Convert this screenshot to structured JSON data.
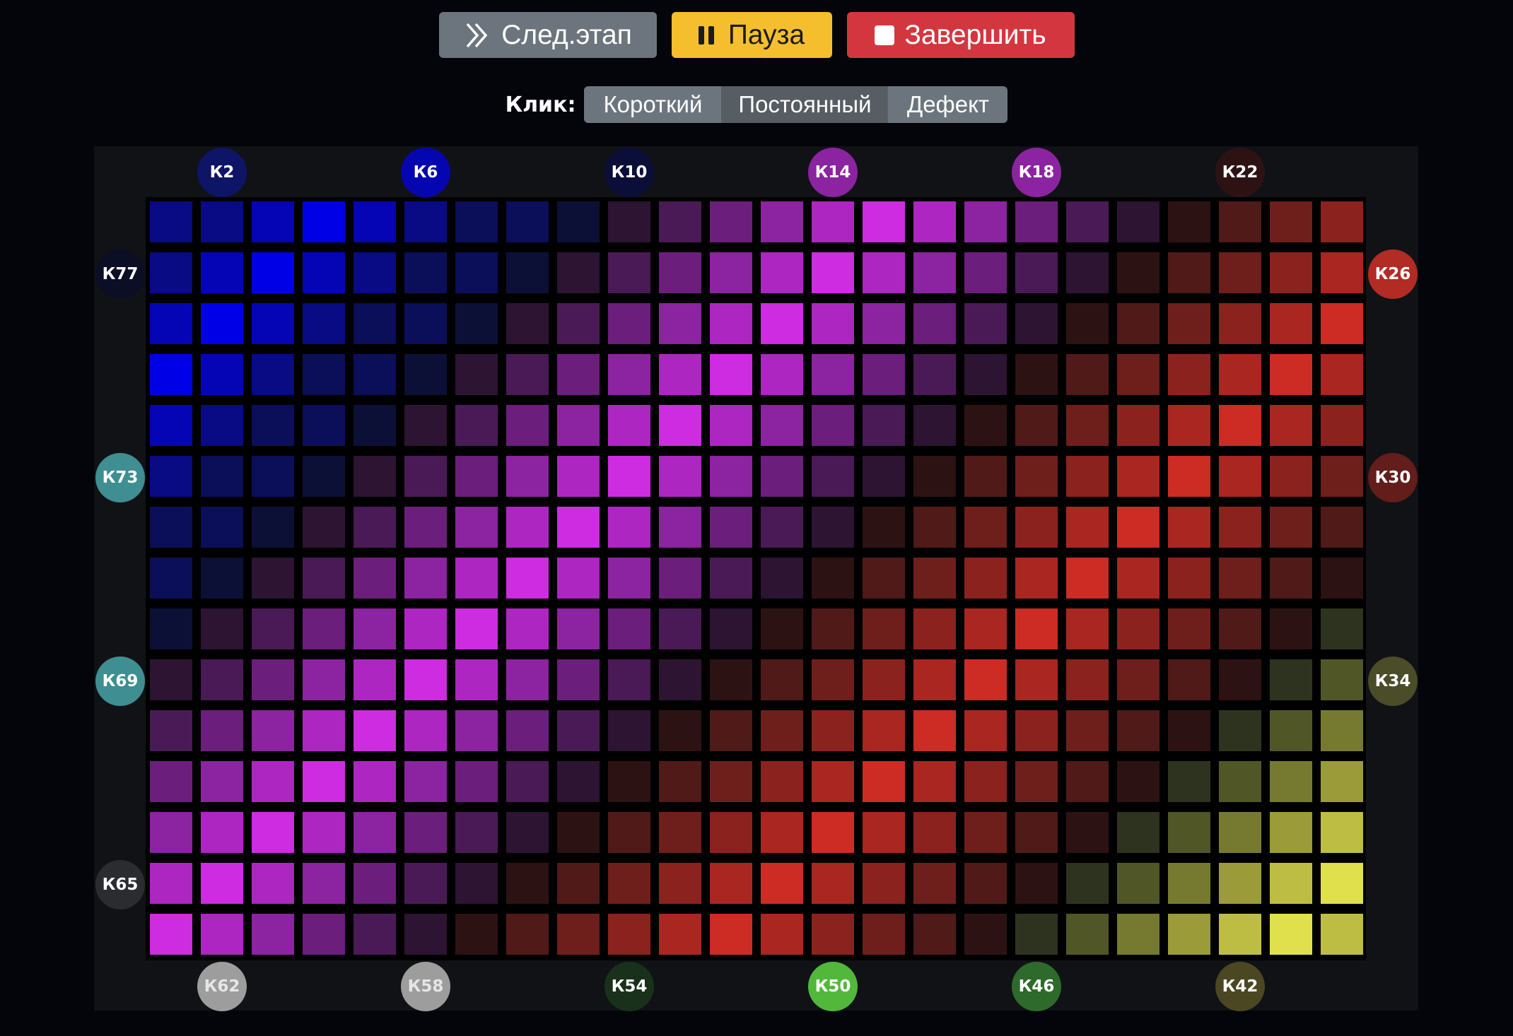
{
  "toolbar": {
    "next_label": "След.этап",
    "next_icon": "double-chevron-right-icon",
    "pause_label": "Пауза",
    "pause_icon": "pause-icon",
    "finish_label": "Завершить",
    "finish_icon": "stop-icon"
  },
  "click_mode": {
    "label": "Клик:",
    "options": [
      "Короткий",
      "Постоянный",
      "Дефект"
    ],
    "selected": "Постоянный"
  },
  "grid": {
    "rows": 15,
    "cols": 24,
    "palette": {
      "B": [
        "#000000",
        "#0c1036",
        "#0b0e58",
        "#080b83",
        "#0505b5",
        "#0000e6"
      ],
      "P": [
        "#000000",
        "#2c1432",
        "#4a1a56",
        "#6c1e7c",
        "#8c23a0",
        "#ad26c2",
        "#cd2ce0"
      ],
      "R": [
        "#000000",
        "#2d1214",
        "#4f1a18",
        "#6e1f1b",
        "#8c221e",
        "#aa2620",
        "#cc2c24"
      ],
      "Y": [
        "#000000",
        "#2e3320",
        "#515627",
        "#767a30",
        "#9b9b39",
        "#bebd43",
        "#e0df4c"
      ]
    },
    "cells": [
      [
        "B3",
        "B3",
        "B4",
        "B5",
        "B4",
        "B3",
        "B2",
        "B2",
        "B1",
        "P1",
        "P2",
        "P3",
        "P4",
        "P5",
        "P6",
        "P5",
        "P4",
        "P3",
        "P2",
        "P1",
        "R1",
        "R2",
        "R3",
        "R4"
      ],
      [
        "B3",
        "B4",
        "B5",
        "B4",
        "B3",
        "B2",
        "B2",
        "B1",
        "P1",
        "P2",
        "P3",
        "P4",
        "P5",
        "P6",
        "P5",
        "P4",
        "P3",
        "P2",
        "P1",
        "R1",
        "R2",
        "R3",
        "R4",
        "R5"
      ],
      [
        "B4",
        "B5",
        "B4",
        "B3",
        "B2",
        "B2",
        "B1",
        "P1",
        "P2",
        "P3",
        "P4",
        "P5",
        "P6",
        "P5",
        "P4",
        "P3",
        "P2",
        "P1",
        "R1",
        "R2",
        "R3",
        "R4",
        "R5",
        "R6"
      ],
      [
        "B5",
        "B4",
        "B3",
        "B2",
        "B2",
        "B1",
        "P1",
        "P2",
        "P3",
        "P4",
        "P5",
        "P6",
        "P5",
        "P4",
        "P3",
        "P2",
        "P1",
        "R1",
        "R2",
        "R3",
        "R4",
        "R5",
        "R6",
        "R5"
      ],
      [
        "B4",
        "B3",
        "B2",
        "B2",
        "B1",
        "P1",
        "P2",
        "P3",
        "P4",
        "P5",
        "P6",
        "P5",
        "P4",
        "P3",
        "P2",
        "P1",
        "R1",
        "R2",
        "R3",
        "R4",
        "R5",
        "R6",
        "R5",
        "R4"
      ],
      [
        "B3",
        "B2",
        "B2",
        "B1",
        "P1",
        "P2",
        "P3",
        "P4",
        "P5",
        "P6",
        "P5",
        "P4",
        "P3",
        "P2",
        "P1",
        "R1",
        "R2",
        "R3",
        "R4",
        "R5",
        "R6",
        "R5",
        "R4",
        "R3"
      ],
      [
        "B2",
        "B2",
        "B1",
        "P1",
        "P2",
        "P3",
        "P4",
        "P5",
        "P6",
        "P5",
        "P4",
        "P3",
        "P2",
        "P1",
        "R1",
        "R2",
        "R3",
        "R4",
        "R5",
        "R6",
        "R5",
        "R4",
        "R3",
        "R2"
      ],
      [
        "B2",
        "B1",
        "P1",
        "P2",
        "P3",
        "P4",
        "P5",
        "P6",
        "P5",
        "P4",
        "P3",
        "P2",
        "P1",
        "R1",
        "R2",
        "R3",
        "R4",
        "R5",
        "R6",
        "R5",
        "R4",
        "R3",
        "R2",
        "R1"
      ],
      [
        "B1",
        "P1",
        "P2",
        "P3",
        "P4",
        "P5",
        "P6",
        "P5",
        "P4",
        "P3",
        "P2",
        "P1",
        "R1",
        "R2",
        "R3",
        "R4",
        "R5",
        "R6",
        "R5",
        "R4",
        "R3",
        "R2",
        "R1",
        "Y1"
      ],
      [
        "P1",
        "P2",
        "P3",
        "P4",
        "P5",
        "P6",
        "P5",
        "P4",
        "P3",
        "P2",
        "P1",
        "R1",
        "R2",
        "R3",
        "R4",
        "R5",
        "R6",
        "R5",
        "R4",
        "R3",
        "R2",
        "R1",
        "Y1",
        "Y2"
      ],
      [
        "P2",
        "P3",
        "P4",
        "P5",
        "P6",
        "P5",
        "P4",
        "P3",
        "P2",
        "P1",
        "R1",
        "R2",
        "R3",
        "R4",
        "R5",
        "R6",
        "R5",
        "R4",
        "R3",
        "R2",
        "R1",
        "Y1",
        "Y2",
        "Y3"
      ],
      [
        "P3",
        "P4",
        "P5",
        "P6",
        "P5",
        "P4",
        "P3",
        "P2",
        "P1",
        "R1",
        "R2",
        "R3",
        "R4",
        "R5",
        "R6",
        "R5",
        "R4",
        "R3",
        "R2",
        "R1",
        "Y1",
        "Y2",
        "Y3",
        "Y4"
      ],
      [
        "P4",
        "P5",
        "P6",
        "P5",
        "P4",
        "P3",
        "P2",
        "P1",
        "R1",
        "R2",
        "R3",
        "R4",
        "R5",
        "R6",
        "R5",
        "R4",
        "R3",
        "R2",
        "R1",
        "Y1",
        "Y2",
        "Y3",
        "Y4",
        "Y5"
      ],
      [
        "P5",
        "P6",
        "P5",
        "P4",
        "P3",
        "P2",
        "P1",
        "R1",
        "R2",
        "R3",
        "R4",
        "R5",
        "R6",
        "R5",
        "R4",
        "R3",
        "R2",
        "R1",
        "Y1",
        "Y2",
        "Y3",
        "Y4",
        "Y5",
        "Y6"
      ],
      [
        "P6",
        "P5",
        "P4",
        "P3",
        "P2",
        "P1",
        "R1",
        "R2",
        "R3",
        "R4",
        "R5",
        "R6",
        "R5",
        "R4",
        "R3",
        "R2",
        "R1",
        "Y1",
        "Y2",
        "Y3",
        "Y4",
        "Y5",
        "Y6",
        "Y5"
      ]
    ]
  },
  "channels": {
    "top": [
      {
        "label": "К2",
        "color": "#0e1466",
        "text": "#ffffff"
      },
      {
        "label": "К6",
        "color": "#0606b0",
        "text": "#ffffff"
      },
      {
        "label": "К10",
        "color": "#0b0e38",
        "text": "#ffffff"
      },
      {
        "label": "К14",
        "color": "#8c23a0",
        "text": "#ffffff"
      },
      {
        "label": "К18",
        "color": "#8c23a0",
        "text": "#ffffff"
      },
      {
        "label": "К22",
        "color": "#2d1214",
        "text": "#ffffff"
      }
    ],
    "right": [
      {
        "label": "К26",
        "color": "#b22b25",
        "text": "#ffffff"
      },
      {
        "label": "К30",
        "color": "#631d1b",
        "text": "#ffffff"
      },
      {
        "label": "К34",
        "color": "#4b4c28",
        "text": "#ffffff"
      }
    ],
    "bottom": [
      {
        "label": "К62",
        "color": "#9d9d9d",
        "text": "#e6e6e6"
      },
      {
        "label": "К58",
        "color": "#9d9d9d",
        "text": "#e6e6e6"
      },
      {
        "label": "К54",
        "color": "#19311a",
        "text": "#ffffff"
      },
      {
        "label": "К50",
        "color": "#52b83b",
        "text": "#ffffff"
      },
      {
        "label": "К46",
        "color": "#2d6a2b",
        "text": "#ffffff"
      },
      {
        "label": "К42",
        "color": "#4a4722",
        "text": "#ffffff"
      }
    ],
    "left": [
      {
        "label": "К77",
        "color": "#0b0e24",
        "text": "#ffffff"
      },
      {
        "label": "К73",
        "color": "#3f8e91",
        "text": "#ffffff"
      },
      {
        "label": "К69",
        "color": "#3f8e91",
        "text": "#ffffff"
      },
      {
        "label": "К65",
        "color": "#2b2c30",
        "text": "#ffffff"
      }
    ]
  }
}
